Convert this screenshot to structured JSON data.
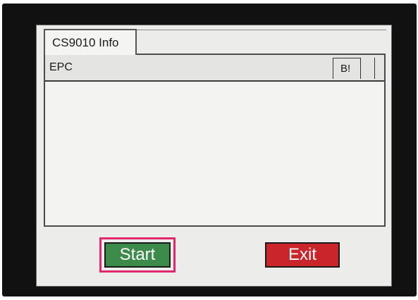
{
  "window": {
    "tab_title": "CS9010 Info"
  },
  "list": {
    "columns": [
      "EPC",
      "B!"
    ],
    "rows": []
  },
  "buttons": {
    "start_label": "Start",
    "exit_label": "Exit"
  },
  "colors": {
    "start_button": "#3d8b4a",
    "exit_button": "#c9252a",
    "highlight_outline": "#e3286e",
    "screen_background": "#ececea"
  }
}
